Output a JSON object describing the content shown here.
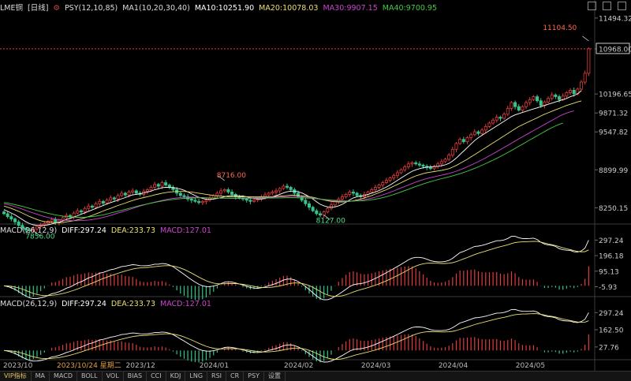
{
  "header": {
    "instrument": "LME铜",
    "period": "[日线]",
    "indicator_psy": "PSY(12,10,85)",
    "ma_label": "MA1(10,20,30,40)",
    "ma10": "MA10:10251.90",
    "ma20": "MA20:10078.03",
    "ma30": "MA30:9907.15",
    "ma40": "MA40:9700.95"
  },
  "macd_header": {
    "name": "MACD(26,12,9)",
    "diff": "DIFF:297.24",
    "dea": "DEA:233.73",
    "macd": "MACD:127.01"
  },
  "colors": {
    "up": "#e03c3c",
    "down": "#35c48a",
    "ma10": "#ffffff",
    "ma20": "#e8e070",
    "ma30": "#cc44cc",
    "ma40": "#44cc44",
    "diff": "#ffffff",
    "dea": "#e8e070"
  },
  "chart_data": [
    {
      "type": "candlestick",
      "title": "LME铜 [日线]",
      "x_tick_labels": [
        "2023/10",
        "2023/12",
        "2024/01",
        "2024/02",
        "2024/03",
        "2024/04",
        "2024/05"
      ],
      "crosshair_date_label": "2023/10/24 星期二",
      "y_tick_labels": [
        "11494.32",
        "10968.00",
        "10196.65",
        "9871.32",
        "9547.82",
        "8899.99",
        "8250.15"
      ],
      "ylim": [
        8000,
        11560
      ],
      "current_price": "10968.00",
      "annotations": [
        {
          "label": "11104.50",
          "value": 11104.5,
          "kind": "high"
        },
        {
          "label": "8716.00",
          "value": 8716,
          "kind": "high"
        },
        {
          "label": "7856.00",
          "value": 7856,
          "kind": "low"
        },
        {
          "label": "8127.00",
          "value": 8127,
          "kind": "low"
        }
      ],
      "series_close": [
        8150,
        8100,
        8060,
        8010,
        7950,
        7900,
        7870,
        7860,
        7890,
        7930,
        7960,
        7980,
        8020,
        8050,
        8000,
        8040,
        8080,
        8120,
        8100,
        8160,
        8200,
        8180,
        8240,
        8280,
        8260,
        8320,
        8360,
        8330,
        8380,
        8420,
        8400,
        8460,
        8500,
        8470,
        8520,
        8540,
        8500,
        8480,
        8530,
        8560,
        8600,
        8650,
        8620,
        8680,
        8640,
        8600,
        8560,
        8500,
        8460,
        8440,
        8400,
        8380,
        8360,
        8340,
        8360,
        8380,
        8420,
        8460,
        8500,
        8540,
        8560,
        8520,
        8480,
        8440,
        8420,
        8400,
        8380,
        8360,
        8380,
        8400,
        8440,
        8470,
        8500,
        8520,
        8540,
        8580,
        8620,
        8600,
        8560,
        8500,
        8440,
        8380,
        8320,
        8260,
        8200,
        8150,
        8127,
        8180,
        8240,
        8300,
        8360,
        8400,
        8440,
        8480,
        8520,
        8500,
        8460,
        8440,
        8480,
        8520,
        8560,
        8600,
        8640,
        8680,
        8720,
        8760,
        8800,
        8850,
        8900,
        8950,
        9000,
        9020,
        9000,
        8980,
        8960,
        8940,
        8920,
        8960,
        9000,
        9040,
        9080,
        9150,
        9250,
        9350,
        9420,
        9380,
        9450,
        9500,
        9550,
        9520,
        9580,
        9640,
        9700,
        9750,
        9800,
        9780,
        9850,
        9950,
        10050,
        9980,
        9920,
        9980,
        10050,
        10100,
        10150,
        10080,
        10000,
        10060,
        10120,
        10180,
        10150,
        10100,
        10160,
        10220,
        10260,
        10200,
        10280,
        10400,
        10550,
        10968
      ],
      "ma_series": [
        {
          "name": "MA10",
          "values": [
            8220,
            8190,
            8160,
            8130,
            8090,
            8050,
            8010,
            7980,
            7960,
            7950,
            7945,
            7950,
            7960,
            7975,
            7990,
            8005,
            8025,
            8050,
            8070,
            8090,
            8115,
            8140,
            8165,
            8190,
            8215,
            8240,
            8265,
            8290,
            8315,
            8340,
            8360,
            8380,
            8405,
            8425,
            8450,
            8470,
            8480,
            8490,
            8505,
            8520,
            8535,
            8560,
            8575,
            8595,
            8600,
            8600,
            8595,
            8585,
            8570,
            8550,
            8520,
            8490,
            8460,
            8430,
            8410,
            8395,
            8395,
            8400,
            8410,
            8425,
            8440,
            8455,
            8460,
            8460,
            8455,
            8450,
            8440,
            8425,
            8410,
            8400,
            8400,
            8410,
            8425,
            8440,
            8460,
            8480,
            8505,
            8525,
            8535,
            8535,
            8525,
            8505,
            8475,
            8440,
            8400,
            8355,
            8310,
            8285,
            8265,
            8260,
            8265,
            8285,
            8310,
            8345,
            8385,
            8420,
            8440,
            8450,
            8460,
            8480,
            8500,
            8520,
            8545,
            8575,
            8605,
            8640,
            8680,
            8720,
            8760,
            8800,
            8840,
            8875,
            8900,
            8920,
            8935,
            8945,
            8950,
            8955,
            8960,
            8970,
            8985,
            9010,
            9050,
            9100,
            9160,
            9220,
            9280,
            9340,
            9400,
            9450,
            9490,
            9530,
            9570,
            9610,
            9650,
            9690,
            9730,
            9770,
            9810,
            9840,
            9860,
            9880,
            9900,
            9920,
            9940,
            9960,
            9980,
            10000,
            10020,
            10040,
            10060,
            10080,
            10100,
            10120,
            10150,
            10170,
            10200,
            10251.9
          ]
        },
        {
          "name": "MA20",
          "values": [
            8280,
            8260,
            8240,
            8215,
            8190,
            8160,
            8130,
            8100,
            8075,
            8050,
            8030,
            8015,
            8005,
            8000,
            7995,
            7995,
            8000,
            8010,
            8020,
            8030,
            8045,
            8060,
            8080,
            8100,
            8120,
            8145,
            8170,
            8195,
            8220,
            8240,
            8265,
            8290,
            8310,
            8330,
            8355,
            8375,
            8395,
            8410,
            8425,
            8440,
            8455,
            8470,
            8485,
            8500,
            8510,
            8520,
            8525,
            8530,
            8530,
            8530,
            8525,
            8520,
            8510,
            8500,
            8490,
            8480,
            8470,
            8460,
            8455,
            8450,
            8445,
            8440,
            8440,
            8440,
            8440,
            8440,
            8440,
            8440,
            8440,
            8440,
            8440,
            8440,
            8440,
            8440,
            8445,
            8450,
            8455,
            8460,
            8465,
            8465,
            8460,
            8455,
            8450,
            8440,
            8430,
            8415,
            8400,
            8385,
            8370,
            8360,
            8355,
            8350,
            8350,
            8355,
            8360,
            8370,
            8385,
            8400,
            8420,
            8440,
            8460,
            8485,
            8510,
            8535,
            8560,
            8590,
            8620,
            8650,
            8680,
            8710,
            8740,
            8770,
            8795,
            8815,
            8835,
            8850,
            8860,
            8870,
            8880,
            8890,
            8905,
            8920,
            8945,
            8975,
            9010,
            9045,
            9080,
            9120,
            9160,
            9200,
            9240,
            9280,
            9320,
            9360,
            9400,
            9440,
            9480,
            9520,
            9560,
            9600,
            9640,
            9670,
            9700,
            9730,
            9760,
            9790,
            9820,
            9850,
            9875,
            9900,
            9925,
            9950,
            9975,
            10000,
            10020,
            10040,
            10060,
            10078.03
          ]
        },
        {
          "name": "MA30",
          "values": [
            8320,
            8305,
            8290,
            8270,
            8250,
            8228,
            8205,
            8182,
            8160,
            8140,
            8120,
            8100,
            8085,
            8070,
            8058,
            8048,
            8040,
            8035,
            8032,
            8030,
            8030,
            8032,
            8036,
            8042,
            8050,
            8060,
            8072,
            8086,
            8102,
            8120,
            8140,
            8160,
            8180,
            8200,
            8220,
            8240,
            8260,
            8280,
            8298,
            8315,
            8332,
            8348,
            8362,
            8376,
            8390,
            8402,
            8412,
            8420,
            8426,
            8430,
            8432,
            8432,
            8430,
            8428,
            8425,
            8422,
            8420,
            8418,
            8416,
            8415,
            8414,
            8414,
            8414,
            8415,
            8416,
            8418,
            8420,
            8422,
            8424,
            8425,
            8426,
            8428,
            8430,
            8432,
            8434,
            8436,
            8438,
            8440,
            8441,
            8441,
            8440,
            8438,
            8434,
            8428,
            8420,
            8410,
            8400,
            8390,
            8380,
            8372,
            8366,
            8362,
            8360,
            8360,
            8362,
            8366,
            8372,
            8380,
            8390,
            8402,
            8416,
            8432,
            8450,
            8470,
            8492,
            8515,
            8540,
            8565,
            8590,
            8615,
            8640,
            8665,
            8690,
            8712,
            8732,
            8750,
            8766,
            8780,
            8794,
            8808,
            8822,
            8838,
            8856,
            8876,
            8900,
            8925,
            8952,
            8980,
            9010,
            9040,
            9072,
            9105,
            9140,
            9175,
            9210,
            9246,
            9282,
            9318,
            9355,
            9392,
            9430,
            9465,
            9500,
            9535,
            9570,
            9605,
            9640,
            9675,
            9710,
            9745,
            9780,
            9815,
            9845,
            9870,
            9890,
            9907.15
          ]
        },
        {
          "name": "MA40",
          "values": [
            8340,
            8330,
            8318,
            8305,
            8290,
            8275,
            8258,
            8240,
            8222,
            8205,
            8188,
            8172,
            8157,
            8143,
            8130,
            8118,
            8108,
            8100,
            8094,
            8090,
            8088,
            8088,
            8090,
            8094,
            8100,
            8108,
            8118,
            8130,
            8144,
            8160,
            8176,
            8192,
            8208,
            8224,
            8240,
            8256,
            8272,
            8288,
            8302,
            8316,
            8330,
            8343,
            8355,
            8366,
            8376,
            8385,
            8393,
            8400,
            8406,
            8411,
            8415,
            8418,
            8420,
            8421,
            8421,
            8420,
            8419,
            8418,
            8417,
            8416,
            8415,
            8414,
            8413,
            8412,
            8412,
            8412,
            8412,
            8412,
            8413,
            8414,
            8415,
            8416,
            8417,
            8418,
            8419,
            8420,
            8421,
            8422,
            8422,
            8422,
            8421,
            8420,
            8418,
            8415,
            8411,
            8406,
            8400,
            8394,
            8388,
            8382,
            8377,
            8373,
            8370,
            8368,
            8367,
            8367,
            8368,
            8370,
            8374,
            8380,
            8388,
            8398,
            8410,
            8424,
            8440,
            8458,
            8478,
            8500,
            8522,
            8545,
            8568,
            8592,
            8615,
            8637,
            8658,
            8678,
            8697,
            8715,
            8732,
            8748,
            8764,
            8780,
            8797,
            8815,
            8834,
            8854,
            8876,
            8900,
            8925,
            8951,
            8978,
            9006,
            9035,
            9065,
            9096,
            9128,
            9161,
            9195,
            9230,
            9266,
            9302,
            9338,
            9374,
            9410,
            9446,
            9482,
            9518,
            9554,
            9588,
            9620,
            9650,
            9676,
            9700.95
          ]
        }
      ]
    },
    {
      "type": "macd",
      "title": "MACD(26,12,9)",
      "y_tick_labels": [
        "297.24",
        "196.18",
        "95.13",
        "-5.93"
      ],
      "ylim": [
        -60,
        330
      ],
      "diff_end": 297.24,
      "dea_end": 233.73,
      "macd_end": 127.01
    },
    {
      "type": "macd",
      "title": "MACD(26,12,9)",
      "y_tick_labels": [
        "297.24",
        "162.50",
        "27.76"
      ],
      "ylim": [
        -60,
        330
      ],
      "diff_end": 297.24,
      "dea_end": 233.73,
      "macd_end": 127.01
    }
  ],
  "tabs": [
    "VIP指标",
    "MA",
    "MACD",
    "BOLL",
    "VOL",
    "BIAS",
    "CCI",
    "KDJ",
    "LNG",
    "RSI",
    "CR",
    "PSY",
    "设置"
  ]
}
